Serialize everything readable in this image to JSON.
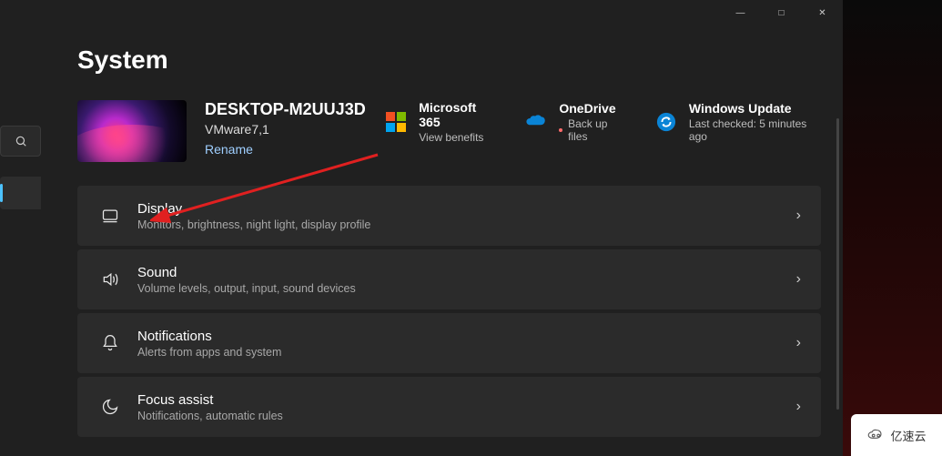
{
  "window_controls": {
    "minimize": "—",
    "maximize": "□",
    "close": "✕"
  },
  "page": {
    "title": "System"
  },
  "device": {
    "name": "DESKTOP-M2UUJ3D",
    "model": "VMware7,1",
    "rename_label": "Rename"
  },
  "cards": {
    "m365": {
      "title": "Microsoft 365",
      "sub": "View benefits"
    },
    "onedrive": {
      "title": "OneDrive",
      "sub": "Back up files"
    },
    "update": {
      "title": "Windows Update",
      "sub": "Last checked: 5 minutes ago"
    }
  },
  "items": [
    {
      "title": "Display",
      "sub": "Monitors, brightness, night light, display profile"
    },
    {
      "title": "Sound",
      "sub": "Volume levels, output, input, sound devices"
    },
    {
      "title": "Notifications",
      "sub": "Alerts from apps and system"
    },
    {
      "title": "Focus assist",
      "sub": "Notifications, automatic rules"
    }
  ],
  "watermark": "亿速云"
}
